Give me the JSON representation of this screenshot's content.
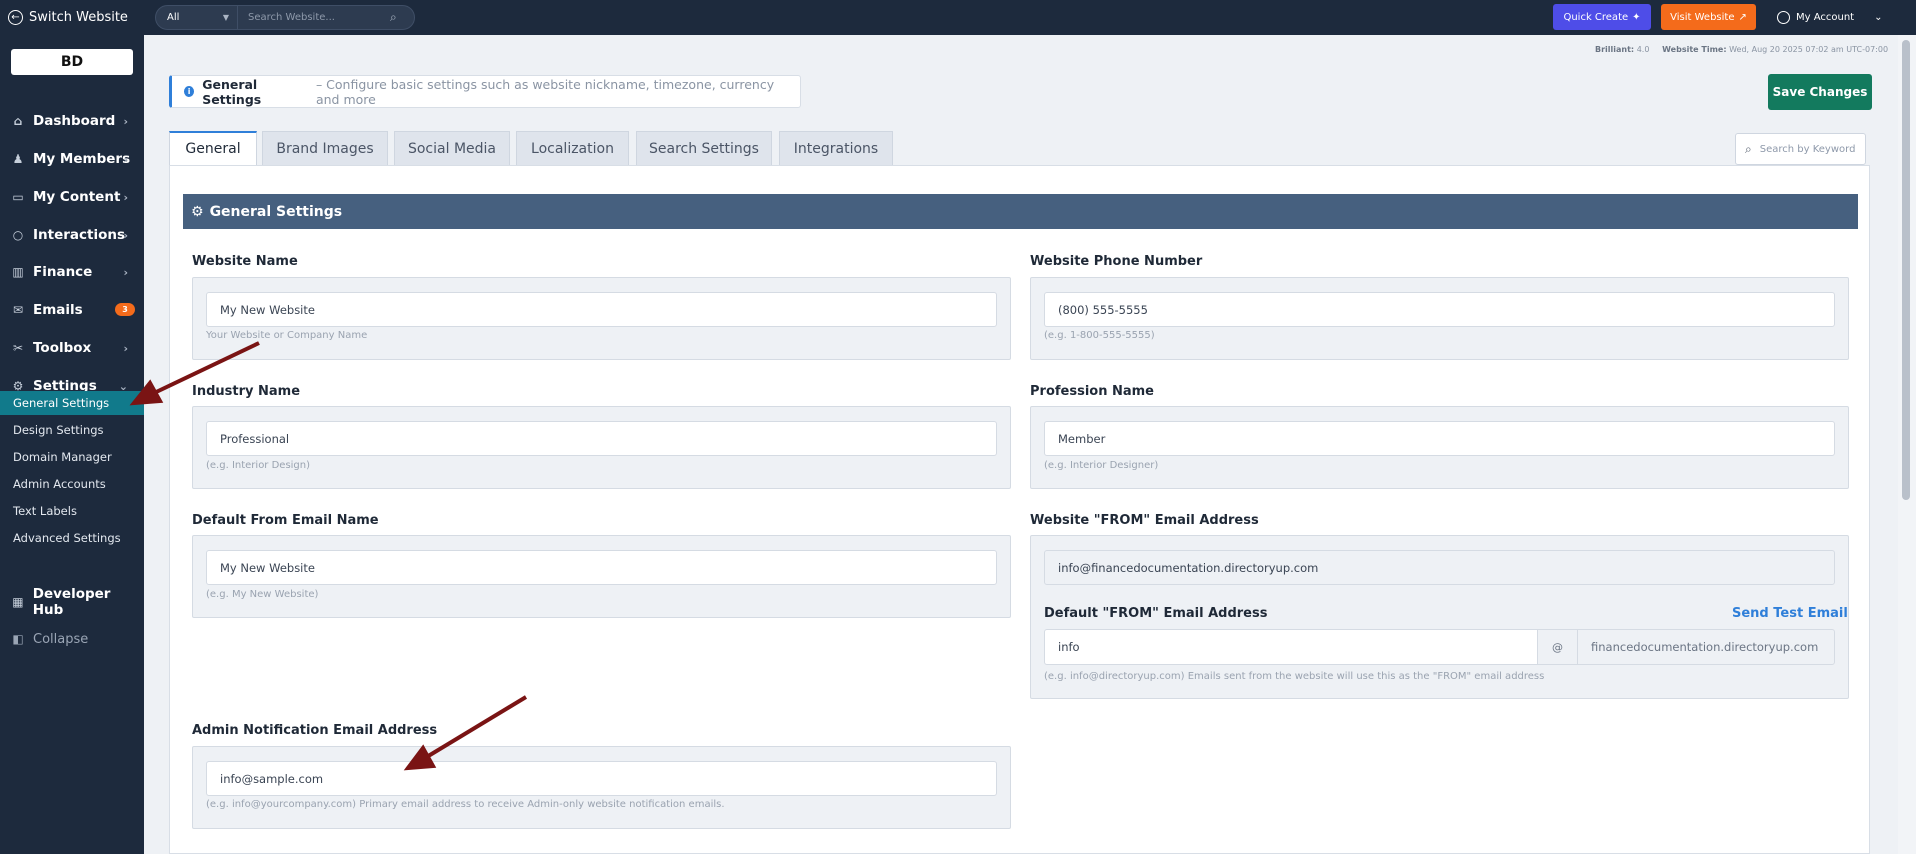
{
  "topbar": {
    "switch_label": "Switch Website",
    "filter_value": "All",
    "search_placeholder": "Search Website...",
    "quick_create": "Quick Create",
    "visit_website": "Visit Website",
    "account": "My Account"
  },
  "sidebar": {
    "logo_text": "BD",
    "items": [
      {
        "label": "Dashboard",
        "icon": "home-icon"
      },
      {
        "label": "My Members",
        "icon": "members-icon"
      },
      {
        "label": "My Content",
        "icon": "content-icon"
      },
      {
        "label": "Interactions",
        "icon": "chat-icon"
      },
      {
        "label": "Finance",
        "icon": "finance-icon"
      },
      {
        "label": "Emails",
        "icon": "mail-icon",
        "badge": "3"
      },
      {
        "label": "Toolbox",
        "icon": "tools-icon"
      },
      {
        "label": "Settings",
        "icon": "gear-icon"
      }
    ],
    "settings_sub": [
      "General Settings",
      "Design Settings",
      "Domain Manager",
      "Admin Accounts",
      "Text Labels",
      "Advanced Settings"
    ],
    "developer_hub": "Developer Hub",
    "collapse": "Collapse"
  },
  "meta": {
    "brilliant_label": "Brilliant:",
    "brilliant_value": "4.0",
    "time_label": "Website Time:",
    "time_value": "Wed, Aug 20 2025 07:02 am UTC-07:00"
  },
  "infobar": {
    "title": "General Settings",
    "desc": "– Configure basic settings such as website nickname, timezone, currency and more"
  },
  "save_label": "Save Changes",
  "tabs": [
    "General",
    "Brand Images",
    "Social Media",
    "Localization",
    "Search Settings",
    "Integrations"
  ],
  "keyword_placeholder": "Search by Keyword",
  "section_title": "General Settings",
  "fields": {
    "website_name": {
      "label": "Website Name",
      "value": "My New Website",
      "help": "Your Website or Company Name"
    },
    "phone": {
      "label": "Website Phone Number",
      "value": "(800) 555-5555",
      "help": "(e.g. 1-800-555-5555)"
    },
    "industry": {
      "label": "Industry Name",
      "value": "Professional",
      "help": "(e.g. Interior Design)"
    },
    "profession": {
      "label": "Profession Name",
      "value": "Member",
      "help": "(e.g. Interior Designer)"
    },
    "from_name": {
      "label": "Default From Email Name",
      "value": "My New Website",
      "help": "(e.g. My New Website)"
    },
    "from_email": {
      "label": "Website \"FROM\" Email Address",
      "value": "info@financedocumentation.directoryup.com"
    },
    "default_from": {
      "label": "Default \"FROM\" Email Address",
      "send_test": "Send Test Email",
      "local": "info",
      "at": "@",
      "domain": "financedocumentation.directoryup.com",
      "help": "(e.g. info@directoryup.com) Emails sent from the website will use this as the \"FROM\" email address"
    },
    "admin_email": {
      "label": "Admin Notification Email Address",
      "value": "info@sample.com",
      "help": "(e.g. info@yourcompany.com) Primary email address to receive Admin-only website notification emails."
    }
  },
  "colors": {
    "sidebar": "#1d2a3d",
    "accent": "#2f7fd9",
    "active_nav": "#117a8b",
    "save": "#137a5e",
    "arrow": "#7a1414"
  }
}
